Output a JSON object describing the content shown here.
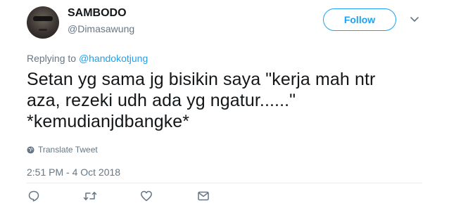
{
  "user": {
    "display_name": "SAMBODO",
    "handle": "@Dimasawung",
    "avatar_icon": "avatar-photo"
  },
  "follow_button": {
    "label": "Follow",
    "color": "#1da1f2"
  },
  "reply_context": {
    "prefix": "Replying to ",
    "mention": "@handokotjung"
  },
  "tweet": {
    "lines": [
      "Setan yg sama jg bisikin saya \"kerja mah ntr",
      "aza, rezeki udh ada yg ngatur......\"",
      "*kemudianjdbangke*"
    ]
  },
  "translate": {
    "label": "Translate Tweet",
    "icon": "globe-icon"
  },
  "timestamp": "2:51 PM - 4 Oct 2018",
  "actions": [
    {
      "name": "reply",
      "icon": "reply-icon"
    },
    {
      "name": "retweet",
      "icon": "retweet-icon"
    },
    {
      "name": "like",
      "icon": "heart-icon"
    },
    {
      "name": "message",
      "icon": "envelope-icon"
    }
  ],
  "colors": {
    "text": "#14171a",
    "secondary": "#657786",
    "accent": "#1da1f2"
  }
}
